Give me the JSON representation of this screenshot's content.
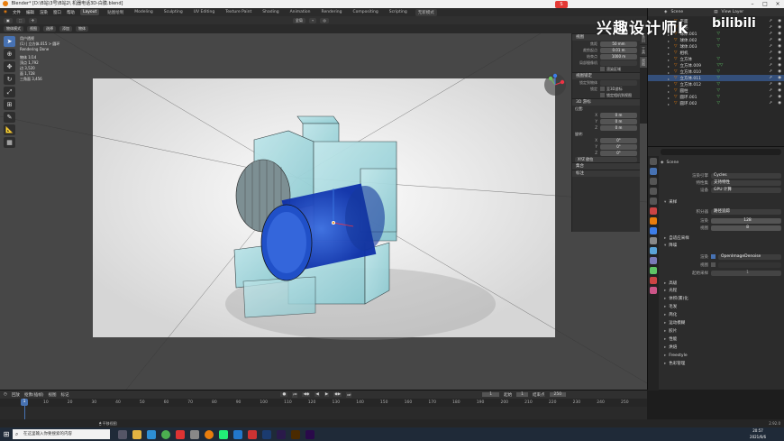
{
  "window": {
    "title": "Blender* [D:\\B站\\3号\\B站2\\ 机器电话3D-白膜.blend]"
  },
  "menu": [
    "文件",
    "编辑",
    "渲染",
    "窗口",
    "帮助"
  ],
  "workspaces": [
    "Layout",
    "贴图绘制",
    "Modeling",
    "Sculpting",
    "UV Editing",
    "Texture Paint",
    "Shading",
    "Animation",
    "Rendering",
    "Compositing",
    "Scripting"
  ],
  "workspace_active": "Layout",
  "top_right_button": "无新模式",
  "viewport_header": {
    "mode": "物体模式",
    "view": "视图",
    "select": "选择",
    "add": "添加",
    "object": "物体",
    "global": "全局"
  },
  "viewport_overlay": {
    "line1": "用户透视",
    "line2": "(1) | 立方体.015 > 圆环",
    "line3": "Rendering Done",
    "stats": [
      "物体 1/14",
      "顶点 1,792",
      "边 3,520",
      "面 1,728",
      "三角面 3,456"
    ]
  },
  "npanel": {
    "tabs": [
      "条目",
      "工具",
      "视图"
    ],
    "view_section": "视图",
    "focal_label": "焦距",
    "focal_value": "50 mm",
    "clip_start_label": "裁剪起点",
    "clip_start_value": "0.01 m",
    "clip_end_label": "结束点",
    "clip_end_value": "1000 m",
    "local_camera_label": "局部摄像机",
    "render_region": "渲染区域",
    "view_lock_section": "视图锁定",
    "lock_object_label": "锁定到物体",
    "lock_label": "锁定",
    "lock_to_cursor": "至3D游标",
    "lock_cam_to_view": "锁定相机到视图",
    "cursor_section": "3D 游标",
    "location_label": "位置:",
    "x_label": "X",
    "y_label": "Y",
    "z_label": "Z",
    "loc_x": "0 m",
    "loc_y": "0 m",
    "loc_z": "0 m",
    "rotation_label": "旋转:",
    "rot_x": "0°",
    "rot_y": "0°",
    "rot_z": "0°",
    "rot_mode": "XYZ 欧拉",
    "collections_section": "集合",
    "annotation_section": "标注"
  },
  "outliner": {
    "scene": "Scene",
    "view_layer": "View Layer",
    "rows": [
      {
        "name": "平面",
        "mod": "▽"
      },
      {
        "name": "灯光",
        "mod": ""
      },
      {
        "name": "球体.001",
        "mod": "▽"
      },
      {
        "name": "球体.002",
        "mod": "▽"
      },
      {
        "name": "球体.003",
        "mod": "▽"
      },
      {
        "name": "相机",
        "mod": ""
      },
      {
        "name": "立方体",
        "mod": "▽"
      },
      {
        "name": "立方体.009",
        "mod": "▽▽"
      },
      {
        "name": "立方体.010",
        "mod": "▽"
      },
      {
        "name": "立方体.011",
        "mod": "▽"
      },
      {
        "name": "立方体.012",
        "mod": "▽"
      },
      {
        "name": "圆柱",
        "mod": "▽"
      },
      {
        "name": "圆环.001",
        "mod": "▽"
      },
      {
        "name": "圆环.002",
        "mod": "▽"
      }
    ],
    "selected_index": 9
  },
  "properties": {
    "scene": "Scene",
    "render_engine_label": "渲染引擎",
    "render_engine": "Cycles",
    "feature_set_label": "特性集",
    "feature_set": "支持特性",
    "device_label": "设备",
    "device": "GPU 计算",
    "sampling": "采样",
    "integrator_label": "积分器",
    "integrator": "路径追踪",
    "render_label": "渲染",
    "render_value": "128",
    "viewport_label": "视图",
    "viewport_value": "8",
    "adaptive": "自适应采样",
    "denoise": "降噪",
    "denoise_render_label": "渲染",
    "denoise_render": "OpenImageDenoise",
    "denoise_viewport_label": "视图",
    "start_sample_label": "起始采样",
    "start_sample": "1",
    "advanced": "高级",
    "sections": [
      "光程",
      "体积(雾)化",
      "毛发",
      "简化",
      "运动模糊",
      "胶片",
      "性能",
      "烘焙",
      "Freestyle",
      "色彩管理"
    ]
  },
  "timeline": {
    "playback": "回放",
    "keying": "抠像(插帧)",
    "view": "视图",
    "marker": "标记",
    "current_frame": "1",
    "start_label": "起始",
    "start": "1",
    "end_label": "结束点",
    "end": "250",
    "ruler": [
      "1",
      "10",
      "20",
      "30",
      "40",
      "50",
      "60",
      "70",
      "80",
      "90",
      "100",
      "110",
      "120",
      "130",
      "140",
      "150",
      "160",
      "170",
      "180",
      "190",
      "200",
      "210",
      "220",
      "230",
      "240",
      "250"
    ]
  },
  "status": {
    "left": "平移视图",
    "version": "2.92.0"
  },
  "taskbar": {
    "search": "在这里输入你要搜索的内容",
    "time": "20:57",
    "date": "2021/6/6"
  },
  "watermark": {
    "text": "兴趣设计师k",
    "brand": "bilibili"
  },
  "colors": {
    "accent": "#4772b3",
    "modifier": "#5fc466",
    "blender_orange": "#e87d0d"
  }
}
